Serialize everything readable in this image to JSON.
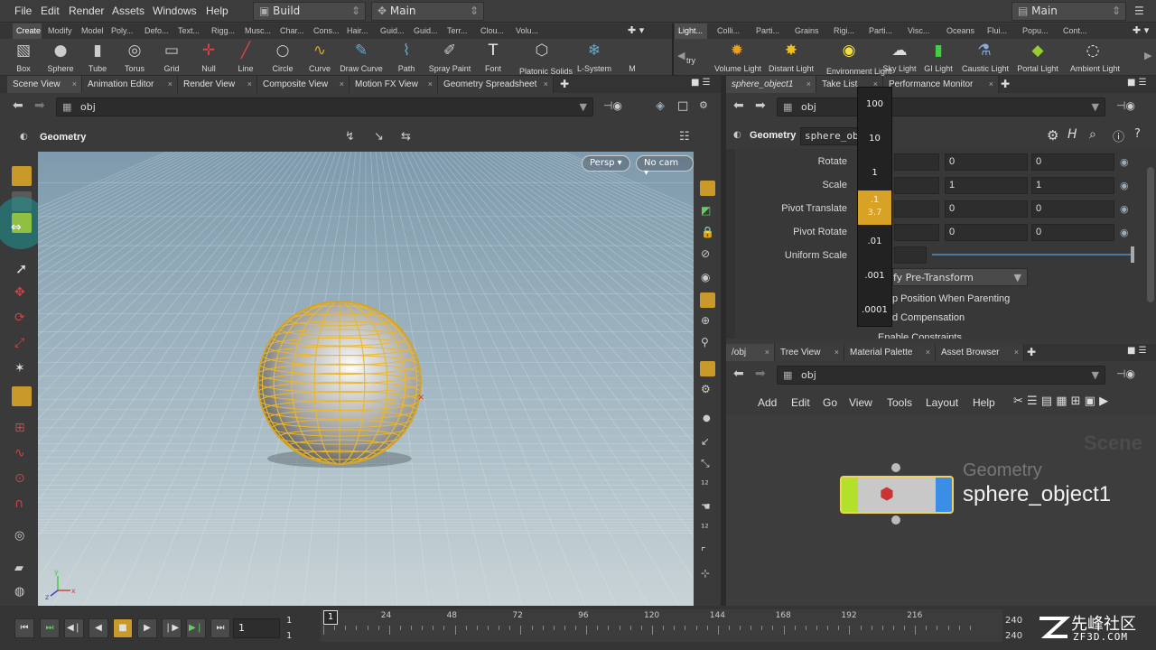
{
  "menubar": {
    "items": [
      "File",
      "Edit",
      "Render",
      "Assets",
      "Windows",
      "Help"
    ],
    "desktop": "Build",
    "context": "Main",
    "context_right": "Main"
  },
  "shelf_tabs_left": [
    "Create",
    "Modify",
    "Model",
    "Poly...",
    "Defo...",
    "Text...",
    "Rigg...",
    "Musc...",
    "Char...",
    "Cons...",
    "Hair...",
    "Guid...",
    "Guid...",
    "Terr...",
    "Clou...",
    "Volu..."
  ],
  "shelf_tabs_right": [
    "Light...",
    "Colli...",
    "Parti...",
    "Grains",
    "Rigi...",
    "Parti...",
    "Visc...",
    "Oceans",
    "Flui...",
    "Popu...",
    "Cont..."
  ],
  "tools_left": [
    {
      "label": "Box",
      "icon": "box-icon"
    },
    {
      "label": "Sphere",
      "icon": "sphere-icon"
    },
    {
      "label": "Tube",
      "icon": "tube-icon"
    },
    {
      "label": "Torus",
      "icon": "torus-icon"
    },
    {
      "label": "Grid",
      "icon": "grid-icon"
    },
    {
      "label": "Null",
      "icon": "null-icon"
    },
    {
      "label": "Line",
      "icon": "line-icon"
    },
    {
      "label": "Circle",
      "icon": "circle-icon"
    },
    {
      "label": "Curve",
      "icon": "curve-icon"
    },
    {
      "label": "Draw Curve",
      "icon": "draw-curve-icon"
    },
    {
      "label": "Path",
      "icon": "path-icon"
    },
    {
      "label": "Spray Paint",
      "icon": "spray-paint-icon"
    },
    {
      "label": "Font",
      "icon": "font-icon"
    },
    {
      "label": "Platonic Solids",
      "icon": "platonic-icon"
    },
    {
      "label": "L-System",
      "icon": "lsystem-icon"
    },
    {
      "label": "M",
      "icon": "more-icon"
    }
  ],
  "tools_right": [
    {
      "label": "try",
      "icon": "try-icon"
    },
    {
      "label": "Volume Light",
      "icon": "volume-light-icon"
    },
    {
      "label": "Distant Light",
      "icon": "distant-light-icon"
    },
    {
      "label": "Environment Light",
      "icon": "env-light-icon"
    },
    {
      "label": "Sky Light",
      "icon": "sky-light-icon"
    },
    {
      "label": "GI Light",
      "icon": "gi-light-icon"
    },
    {
      "label": "Caustic Light",
      "icon": "caustic-light-icon"
    },
    {
      "label": "Portal Light",
      "icon": "portal-light-icon"
    },
    {
      "label": "Ambient Light",
      "icon": "ambient-light-icon"
    }
  ],
  "left_tabs": [
    "Scene View",
    "Animation Editor",
    "Render View",
    "Composite View",
    "Motion FX View",
    "Geometry Spreadsheet"
  ],
  "left_path": "obj",
  "viewport": {
    "context": "Geometry",
    "persp": "Persp",
    "cam": "No cam"
  },
  "right_top_tabs": [
    "sphere_object1",
    "Take List",
    "Performance Monitor"
  ],
  "right_path": "obj",
  "params": {
    "type": "Geometry",
    "name": "sphere_ob",
    "rows": [
      {
        "label": "Rotate",
        "v": [
          "0",
          "0"
        ]
      },
      {
        "label": "Scale",
        "v": [
          "1",
          "1"
        ]
      },
      {
        "label": "Pivot Translate",
        "v": [
          "0",
          "0"
        ]
      },
      {
        "label": "Pivot Rotate",
        "v": [
          "0",
          "0"
        ]
      }
    ],
    "uniform_scale": "Uniform Scale",
    "modify": "fy Pre-Transform",
    "keep": "p Position When Parenting",
    "child": "d Compensation",
    "enable": "Enable Constraints"
  },
  "ladder": {
    "steps": [
      "100",
      "10",
      "1",
      ".1",
      ".01",
      ".001",
      ".0001"
    ],
    "active": ".1",
    "active_value": "3.7"
  },
  "network_tabs": [
    "/obj",
    "Tree View",
    "Material Palette",
    "Asset Browser"
  ],
  "network_path": "obj",
  "network_menu": [
    "Add",
    "Edit",
    "Go",
    "View",
    "Tools",
    "Layout",
    "Help"
  ],
  "network": {
    "watermark": "Scene",
    "node_type": "Geometry",
    "node_name": "sphere_object1"
  },
  "timeline": {
    "frame": "1",
    "start": "1",
    "start2": "1",
    "end": "240",
    "end2": "240",
    "ticks": [
      "24",
      "48",
      "72",
      "96",
      "120",
      "144",
      "168",
      "192",
      "216"
    ],
    "current": "1"
  },
  "watermark_text": "先峰社区",
  "watermark_url": "ZF3D.COM",
  "colors": {
    "accent": "#d8a227",
    "node_left": "#b3e02a",
    "node_right": "#3a8ee6",
    "highlight": "#f0d060"
  }
}
